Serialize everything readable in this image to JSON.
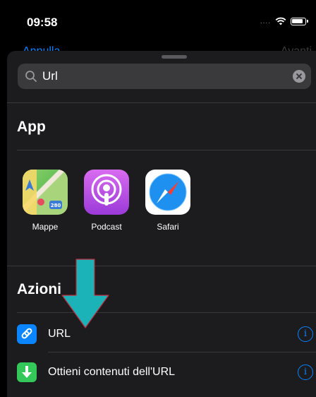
{
  "status_bar": {
    "time": "09:58"
  },
  "nav": {
    "left": "Annulla",
    "right": "Avanti"
  },
  "search": {
    "value": "Url"
  },
  "sections": {
    "apps": "App",
    "actions": "Azioni"
  },
  "apps": [
    {
      "label": "Mappe",
      "icon": "maps-app-icon"
    },
    {
      "label": "Podcast",
      "icon": "podcast-app-icon"
    },
    {
      "label": "Safari",
      "icon": "safari-app-icon"
    }
  ],
  "actions": [
    {
      "label": "URL",
      "icon": "link-icon",
      "icon_color": "#0a84ff"
    },
    {
      "label": "Ottieni contenuti dell'URL",
      "icon": "download-arrow-icon",
      "icon_color": "#34c759"
    }
  ],
  "colors": {
    "accent": "#0a84ff",
    "arrow": "#1bb3b8",
    "arrow_outline": "#c0283a"
  }
}
